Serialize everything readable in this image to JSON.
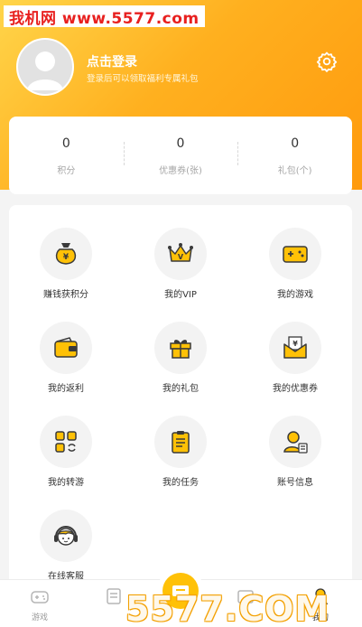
{
  "watermark": {
    "top_text": "我机网 www.5577.com",
    "bottom_text": "5577.COM"
  },
  "profile": {
    "login_title": "点击登录",
    "login_subtitle": "登录后可以领取福利专属礼包"
  },
  "stats": [
    {
      "value": "0",
      "label": "积分"
    },
    {
      "value": "0",
      "label": "优惠券(张)"
    },
    {
      "value": "0",
      "label": "礼包(个)"
    }
  ],
  "menu": [
    {
      "label": "赚钱获积分",
      "icon": "money-bag-icon"
    },
    {
      "label": "我的VIP",
      "icon": "crown-icon"
    },
    {
      "label": "我的游戏",
      "icon": "gamepad-icon"
    },
    {
      "label": "我的返利",
      "icon": "wallet-icon"
    },
    {
      "label": "我的礼包",
      "icon": "gift-icon"
    },
    {
      "label": "我的优惠券",
      "icon": "coupon-icon"
    },
    {
      "label": "我的转游",
      "icon": "transfer-grid-icon"
    },
    {
      "label": "我的任务",
      "icon": "clipboard-icon"
    },
    {
      "label": "账号信息",
      "icon": "account-card-icon"
    },
    {
      "label": "在线客服",
      "icon": "headset-icon"
    }
  ],
  "tabbar": [
    {
      "label": "游戏",
      "icon": "gamepad-tab-icon"
    },
    {
      "label": "",
      "icon": "list-tab-icon"
    },
    {
      "label": "",
      "icon": "box-tab-icon"
    },
    {
      "label": "我的",
      "icon": "user-tab-icon"
    }
  ],
  "colors": {
    "accent": "#ffc107",
    "icon_dark": "#3a3a3a",
    "header_gradient": [
      "#ffd54a",
      "#ff9a0d"
    ]
  }
}
